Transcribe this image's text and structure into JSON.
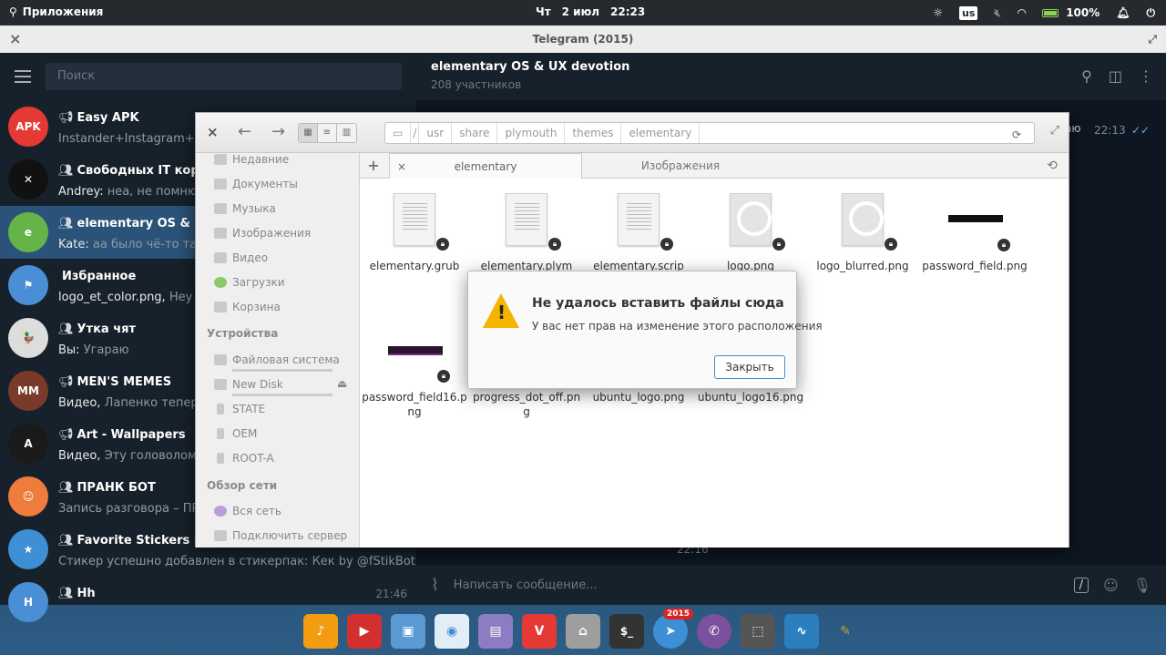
{
  "panel": {
    "apps_label": "Приложения",
    "day": "Чт",
    "date": "2 июл",
    "time": "22:23",
    "kb_layout": "us",
    "battery": "100%"
  },
  "telegram": {
    "window_title": "Telegram (2015)",
    "search_placeholder": "Поиск",
    "chats": [
      {
        "name": "Easy APK",
        "prefix": "",
        "message": "Instander+Instagram+Mod",
        "time": "",
        "avatar": "APK",
        "color": "#e53935"
      },
      {
        "name": "Свободных IT королей",
        "prefix": "Andrey: ",
        "message": "неа, не помню",
        "time": "",
        "avatar": "✕",
        "color": "#111111"
      },
      {
        "name": "elementary OS & UX devotion",
        "prefix": "Kate: ",
        "message": "аа было чё-то такое",
        "time": "",
        "avatar": "e",
        "color": "#64b448"
      },
      {
        "name": "Избранное",
        "prefix": "logo_et_color.png, ",
        "message": "Hey guys",
        "time": "",
        "avatar": "⚑",
        "color": "#4a8fd6"
      },
      {
        "name": "Утка чят",
        "prefix": "Вы: ",
        "message": "Угараю",
        "time": "",
        "avatar": "🦆",
        "color": "#dddddd"
      },
      {
        "name": "MEN'S MEMES",
        "prefix": "Видео, ",
        "message": "Лапенко теперь и",
        "time": "",
        "avatar": "MM",
        "color": "#7a3a2a"
      },
      {
        "name": "Art - Wallpapers",
        "prefix": "Видео, ",
        "message": "Эту головоломку м",
        "time": "",
        "avatar": "A",
        "color": "#1a1a1a"
      },
      {
        "name": "ПРАНК БОТ",
        "prefix": "",
        "message": "Запись разговора – ПРАН",
        "time": "",
        "avatar": "☺",
        "color": "#ef7b3c"
      },
      {
        "name": "Favorite Stickers Bot",
        "prefix": "",
        "message": "Стикер успешно добавлен в стикерпак: Кек by @fStikBot",
        "time": "",
        "avatar": "★",
        "color": "#3d8fd6"
      },
      {
        "name": "Hh",
        "prefix": "",
        "message": "",
        "time": "21:46",
        "avatar": "H",
        "color": "#4a8fd6"
      }
    ],
    "chat_title": "elementary OS & UX devotion",
    "chat_subtitle": "208 участников",
    "visible_fragment": "аю",
    "msg_time_1": "22:13",
    "msg_time_2": "22:16",
    "composer_placeholder": "Написать сообщение..."
  },
  "file_manager": {
    "path": [
      "usr",
      "share",
      "plymouth",
      "themes",
      "elementary"
    ],
    "path_sep": "/",
    "tabs": [
      "elementary",
      "Изображения"
    ],
    "places": [
      "Недавние",
      "Документы",
      "Музыка",
      "Изображения",
      "Видео",
      "Загрузки",
      "Корзина"
    ],
    "devices_header": "Устройства",
    "devices": [
      "Файловая система",
      "New Disk",
      "STATE",
      "OEM",
      "ROOT-A"
    ],
    "network_header": "Обзор сети",
    "network": [
      "Вся сеть",
      "Подключить сервер"
    ],
    "files": [
      {
        "name": "elementary.grub",
        "kind": "doc"
      },
      {
        "name": "elementary.plym",
        "kind": "doc"
      },
      {
        "name": "elementary.scrip",
        "kind": "doc"
      },
      {
        "name": "logo.png",
        "kind": "img"
      },
      {
        "name": "logo_blurred.png",
        "kind": "img"
      },
      {
        "name": "password_field.png",
        "kind": "dark"
      },
      {
        "name": "password_field16.png",
        "kind": "dark-purple"
      },
      {
        "name": "progress_dot_off.png",
        "kind": "hidden"
      },
      {
        "name": "ubuntu_logo.png",
        "kind": "hidden"
      },
      {
        "name": "ubuntu_logo16.png",
        "kind": "hidden"
      }
    ]
  },
  "dialog": {
    "title": "Не удалось вставить файлы сюда",
    "message": "У вас нет прав на изменение этого расположения",
    "button": "Закрыть"
  },
  "dock": {
    "telegram_badge": "2015"
  }
}
